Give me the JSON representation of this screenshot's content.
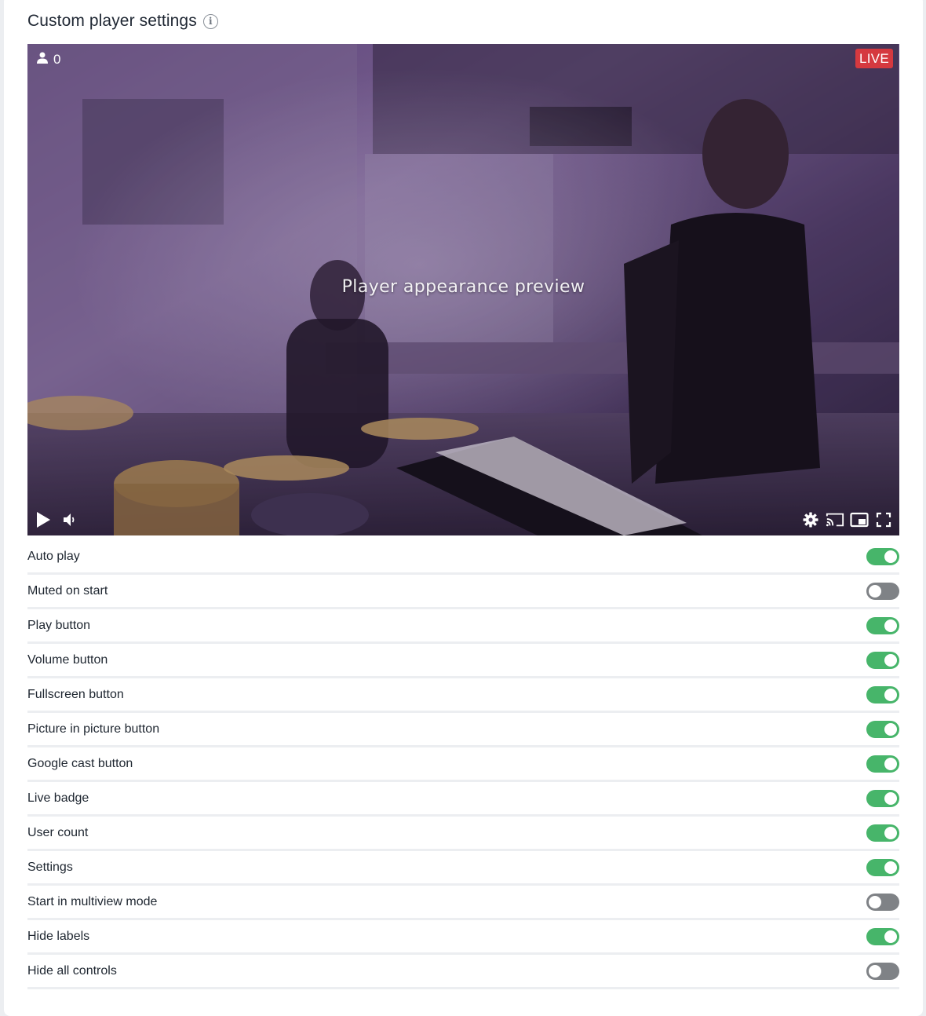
{
  "header": {
    "title": "Custom player settings",
    "info_icon": "info-icon"
  },
  "player": {
    "preview_text": "Player appearance preview",
    "user_count": "0",
    "live_badge": "LIVE",
    "live_color": "#d5393f",
    "controls_left": [
      "play-icon",
      "volume-icon"
    ],
    "controls_right": [
      "gear-icon",
      "cast-icon",
      "picture-in-picture-icon",
      "fullscreen-icon"
    ]
  },
  "settings": [
    {
      "label": "Auto play",
      "enabled": true
    },
    {
      "label": "Muted on start",
      "enabled": false
    },
    {
      "label": "Play button",
      "enabled": true
    },
    {
      "label": "Volume button",
      "enabled": true
    },
    {
      "label": "Fullscreen button",
      "enabled": true
    },
    {
      "label": "Picture in picture button",
      "enabled": true
    },
    {
      "label": "Google cast button",
      "enabled": true
    },
    {
      "label": "Live badge",
      "enabled": true
    },
    {
      "label": "User count",
      "enabled": true
    },
    {
      "label": "Settings",
      "enabled": true
    },
    {
      "label": "Start in multiview mode",
      "enabled": false
    },
    {
      "label": "Hide labels",
      "enabled": true
    },
    {
      "label": "Hide all controls",
      "enabled": false
    }
  ],
  "colors": {
    "toggle_on": "#47b56a",
    "toggle_off": "#7f8286"
  }
}
